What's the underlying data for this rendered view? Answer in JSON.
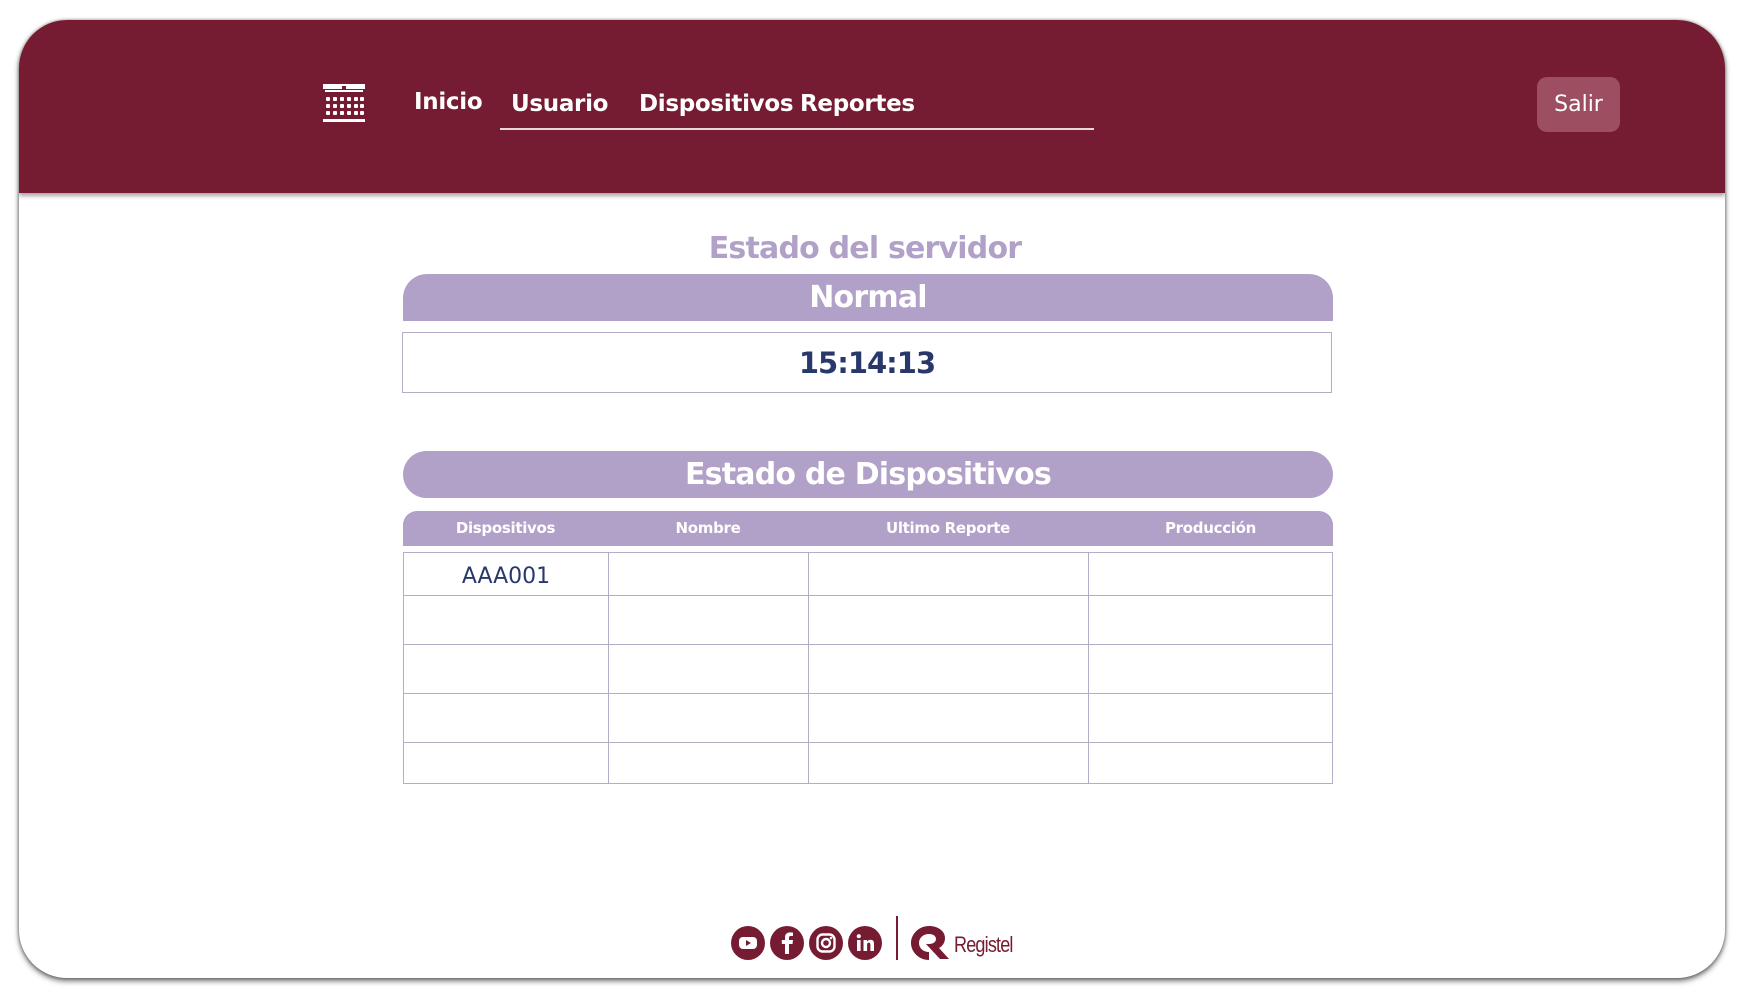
{
  "nav": {
    "items": [
      {
        "label": "Inicio"
      },
      {
        "label": "Usuario"
      },
      {
        "label": "Dispositivos"
      },
      {
        "label": "Reportes"
      }
    ],
    "logout_label": "Salir"
  },
  "server": {
    "title": "Estado del servidor",
    "status": "Normal",
    "time": "15:14:13"
  },
  "devices": {
    "title": "Estado de  Dispositivos",
    "columns": [
      "Dispositivos",
      "Nombre",
      "Ultimo Reporte",
      "Producción"
    ],
    "rows": [
      [
        "AAA001",
        "",
        "",
        ""
      ],
      [
        "",
        "",
        "",
        ""
      ],
      [
        "",
        "",
        "",
        ""
      ],
      [
        "",
        "",
        "",
        ""
      ],
      [
        "",
        "",
        "",
        ""
      ]
    ]
  },
  "footer": {
    "social_icons": [
      "youtube-icon",
      "facebook-icon",
      "instagram-icon",
      "linkedin-icon"
    ],
    "brand": "Registel"
  },
  "colors": {
    "header": "#751c33",
    "accent": "#b1a1c8",
    "text_dark": "#28386b",
    "logout_bg": "#9e4e61"
  }
}
